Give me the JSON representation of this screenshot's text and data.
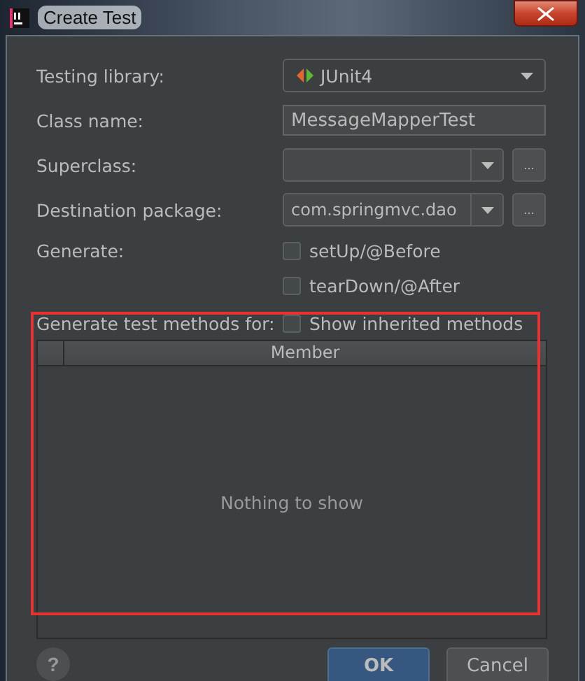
{
  "window": {
    "title": "Create Test"
  },
  "fields": [
    {
      "kind": "combo",
      "label": "Testing library:",
      "value": "JUnit4"
    },
    {
      "kind": "text",
      "label": "Class name:",
      "value": "MessageMapperTest"
    },
    {
      "kind": "combo_browse",
      "label": "Superclass:",
      "browse": "..."
    },
    {
      "kind": "combo_browse",
      "label": "Destination package:",
      "value": "com.springmvc.dao",
      "browse": "..."
    }
  ],
  "generate": {
    "label": "Generate:",
    "options": [
      {
        "label": "setUp/@Before",
        "checked": false
      },
      {
        "label": "tearDown/@After",
        "checked": false
      }
    ]
  },
  "methods": {
    "label": "Generate test methods for:",
    "option": {
      "label": "Show inherited methods",
      "checked": false
    }
  },
  "table": {
    "columns": [
      "Member"
    ],
    "empty_text": "Nothing to show"
  },
  "buttons": [
    {
      "kind": "help",
      "label": "?"
    },
    {
      "kind": "default",
      "label": "OK"
    },
    {
      "kind": "normal",
      "label": "Cancel"
    }
  ]
}
